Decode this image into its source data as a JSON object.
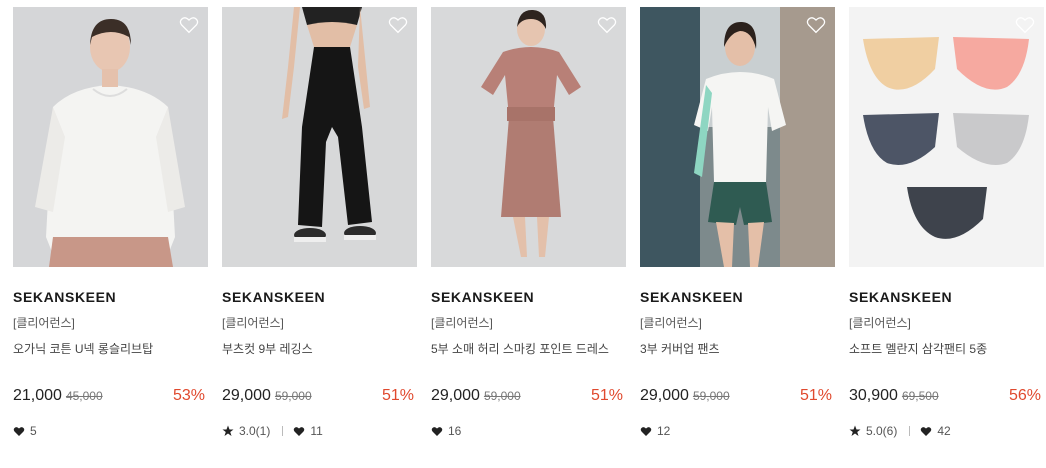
{
  "products": [
    {
      "brand": "SEKANSKEEN",
      "category": "[클리어런스]",
      "name": "오가닉 코튼 U넥 롱슬리브탑",
      "price": "21,000",
      "original_price": "45,000",
      "discount": "53%",
      "rating": "",
      "likes": "5",
      "image": "woman-white-longsleeve"
    },
    {
      "brand": "SEKANSKEEN",
      "category": "[클리어런스]",
      "name": "부츠컷 9부 레깅스",
      "price": "29,000",
      "original_price": "59,000",
      "discount": "51%",
      "rating": "3.0(1)",
      "likes": "11",
      "image": "black-bootcut-leggings"
    },
    {
      "brand": "SEKANSKEEN",
      "category": "[클리어런스]",
      "name": "5부 소매 허리 스마킹 포인트 드레스",
      "price": "29,000",
      "original_price": "59,000",
      "discount": "51%",
      "rating": "",
      "likes": "16",
      "image": "rose-smocked-dress"
    },
    {
      "brand": "SEKANSKEEN",
      "category": "[클리어런스]",
      "name": "3부 커버업 팬츠",
      "price": "29,000",
      "original_price": "59,000",
      "discount": "51%",
      "rating": "",
      "likes": "12",
      "image": "woman-green-shorts"
    },
    {
      "brand": "SEKANSKEEN",
      "category": "[클리어런스]",
      "name": "소프트 멜란지 삼각팬티 5종",
      "price": "30,900",
      "original_price": "69,500",
      "discount": "56%",
      "rating": "5.0(6)",
      "likes": "42",
      "image": "five-briefs-set"
    }
  ],
  "icons": {
    "wishlist": "heart-outline-icon",
    "likes": "heart-filled-icon",
    "rating": "star-icon"
  },
  "colors": {
    "discount": "#e0492e",
    "text": "#222222"
  }
}
